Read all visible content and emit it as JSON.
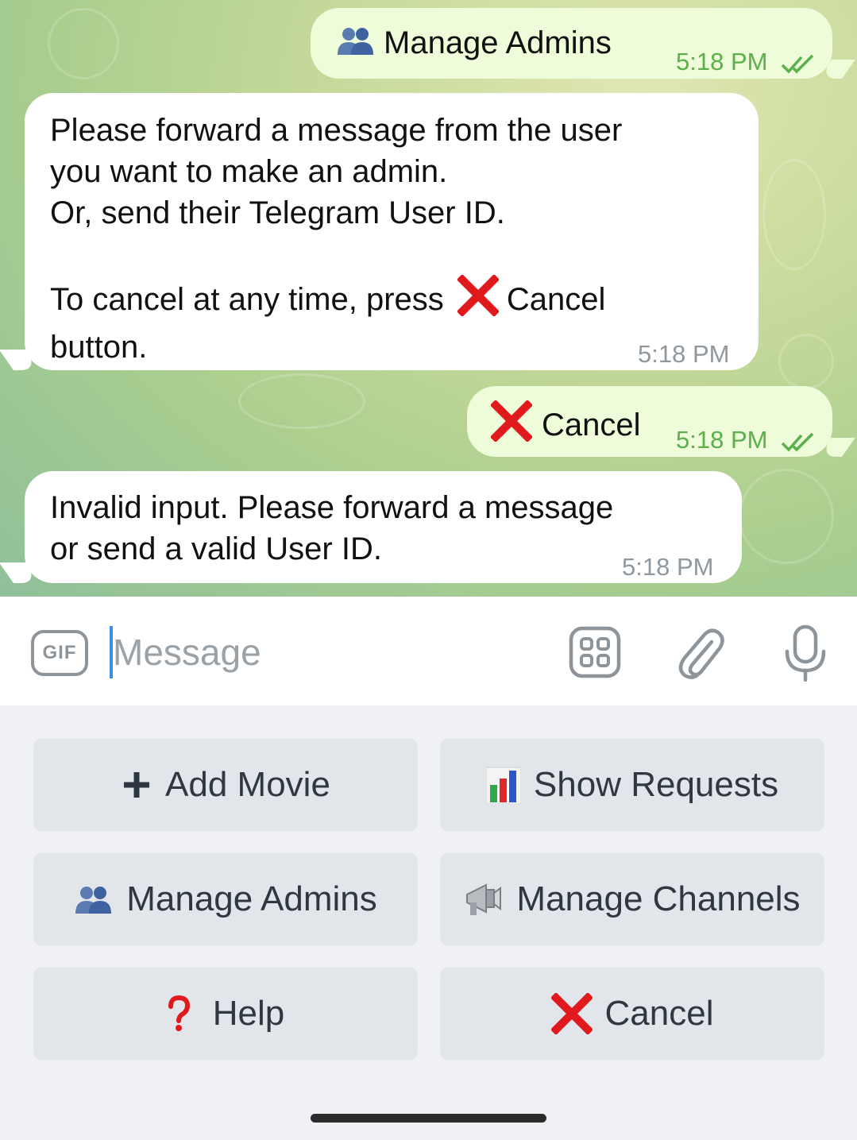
{
  "chat": {
    "messages": [
      {
        "direction": "out",
        "icon": "busts-in-silhouette-icon",
        "text": "Manage Admins",
        "time": "5:18 PM",
        "read": true
      },
      {
        "direction": "in",
        "text": "Please forward a message from the user\nyou want to make an admin.\nOr, send their Telegram User ID.\n\nTo cancel at any time, press",
        "inline_icon": "cross-mark-icon",
        "text_after": "Cancel\nbutton.",
        "time": "5:18 PM"
      },
      {
        "direction": "out",
        "icon": "cross-mark-icon",
        "text": "Cancel",
        "time": "5:18 PM",
        "read": true
      },
      {
        "direction": "in",
        "text": "Invalid input. Please forward a message\nor send a valid User ID.",
        "time": "5:18 PM"
      }
    ]
  },
  "composer": {
    "gif_label": "GIF",
    "placeholder": "Message",
    "value": ""
  },
  "keyboard": {
    "buttons": [
      {
        "icon": "plus-icon",
        "label": "Add Movie"
      },
      {
        "icon": "bar-chart-icon",
        "label": "Show Requests"
      },
      {
        "icon": "busts-in-silhouette-icon",
        "label": "Manage Admins"
      },
      {
        "icon": "megaphone-icon",
        "label": "Manage Channels"
      },
      {
        "icon": "question-mark-icon",
        "label": "Help"
      },
      {
        "icon": "cross-mark-icon",
        "label": "Cancel"
      }
    ]
  },
  "colors": {
    "outgoing_bubble": "#eefcd9",
    "incoming_bubble": "#ffffff",
    "read_check": "#5caf4b",
    "cross_mark": "#e0191d",
    "keyboard_button": "#e2e5ea",
    "cursor": "#3b8fe0"
  }
}
